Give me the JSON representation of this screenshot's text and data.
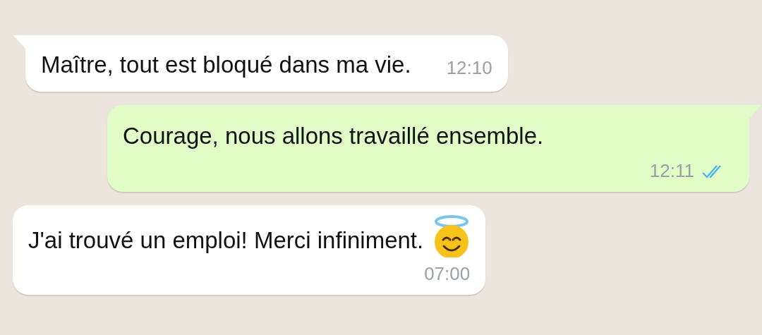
{
  "messages": [
    {
      "kind": "incoming",
      "tail": true,
      "inline_time": true,
      "text": "Maître, tout est bloqué dans ma vie.",
      "time": "12:10"
    },
    {
      "kind": "outgoing",
      "tail": true,
      "inline_time": false,
      "text": "Courage, nous allons travaillé ensemble.",
      "time": "12:11",
      "read": true
    },
    {
      "kind": "incoming",
      "tail": false,
      "inline_time": false,
      "text": "J'ai trouvé un emploi! Merci infiniment.",
      "emoji": true,
      "time": "07:00"
    }
  ]
}
